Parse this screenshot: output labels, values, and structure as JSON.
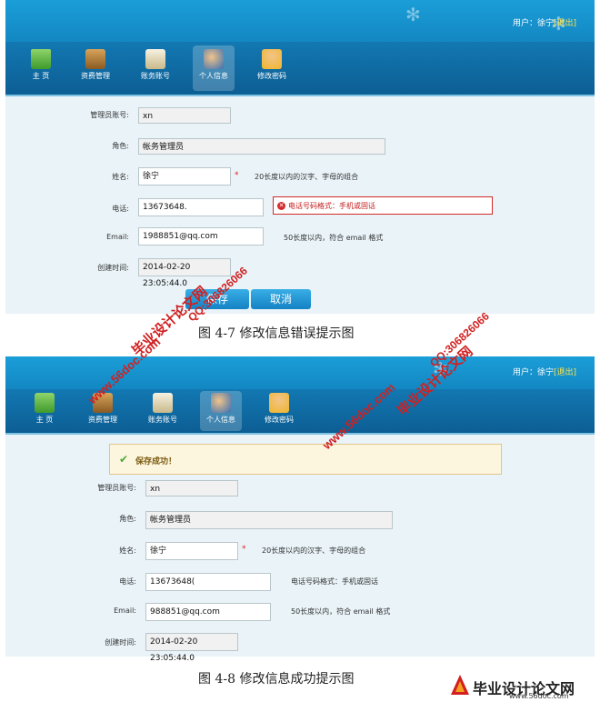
{
  "figure1": {
    "user_label": "用户：",
    "user_name": "徐宁",
    "logout": "[退出]",
    "nav": [
      {
        "label": "主  页",
        "icon": "home-icon"
      },
      {
        "label": "资费管理",
        "icon": "card-reader-icon"
      },
      {
        "label": "账务账号",
        "icon": "document-icon"
      },
      {
        "label": "个人信息",
        "icon": "users-icon"
      },
      {
        "label": "修改密码",
        "icon": "lock-user-icon"
      }
    ],
    "form": {
      "admin_label": "管理员账号:",
      "admin_value": "xn",
      "role_label": "角色:",
      "role_value": "帐务管理员",
      "name_label": "姓名:",
      "name_value": "徐宁",
      "name_required": "*",
      "name_hint": "20长度以内的汉字、字母的组合",
      "phone_label": "电话:",
      "phone_value": "13673648.",
      "phone_error": "电话号码格式：手机或固话",
      "email_label": "Email:",
      "email_value": "1988851@qq.com",
      "email_hint": "50长度以内，符合 email 格式",
      "created_label": "创建时间:",
      "created_value": "2014-02-20 23:05:44.0",
      "save_button": "保存",
      "cancel_button": "取消"
    },
    "caption": "图 4-7  修改信息错误提示图"
  },
  "figure2": {
    "user_label": "用户：",
    "user_name": "徐宁",
    "logout": "[退出]",
    "nav": [
      {
        "label": "主  页",
        "icon": "home-icon"
      },
      {
        "label": "资费管理",
        "icon": "card-reader-icon"
      },
      {
        "label": "账务账号",
        "icon": "document-icon"
      },
      {
        "label": "个人信息",
        "icon": "users-icon"
      },
      {
        "label": "修改密码",
        "icon": "lock-user-icon"
      }
    ],
    "success_message": "保存成功！",
    "form": {
      "admin_label": "管理员账号:",
      "admin_value": "xn",
      "role_label": "角色:",
      "role_value": "帐务管理员",
      "name_label": "姓名:",
      "name_value": "徐宁",
      "name_required": "*",
      "name_hint": "20长度以内的汉字、字母的组合",
      "phone_label": "电话:",
      "phone_value": "13673648(",
      "phone_hint": "电话号码格式：手机或固话",
      "email_label": "Email:",
      "email_value": "988851@qq.com",
      "email_hint": "50长度以内，符合 email 格式",
      "created_label": "创建时间:",
      "created_value": "2014-02-20 23:05:44.0"
    },
    "caption": "图 4-8  修改信息成功提示图"
  },
  "watermarks": {
    "qq": "QQ:306826066",
    "site_name": "毕业设计论文网",
    "site_url": "www.56doc.com"
  },
  "logo": {
    "name": "毕业设计论文网",
    "url": "www.56doc.com"
  },
  "colors": {
    "header_blue": "#1b9ed8",
    "nav_blue": "#1378b2",
    "error_red": "#d12a2a",
    "success_bg": "#fdf6df"
  }
}
